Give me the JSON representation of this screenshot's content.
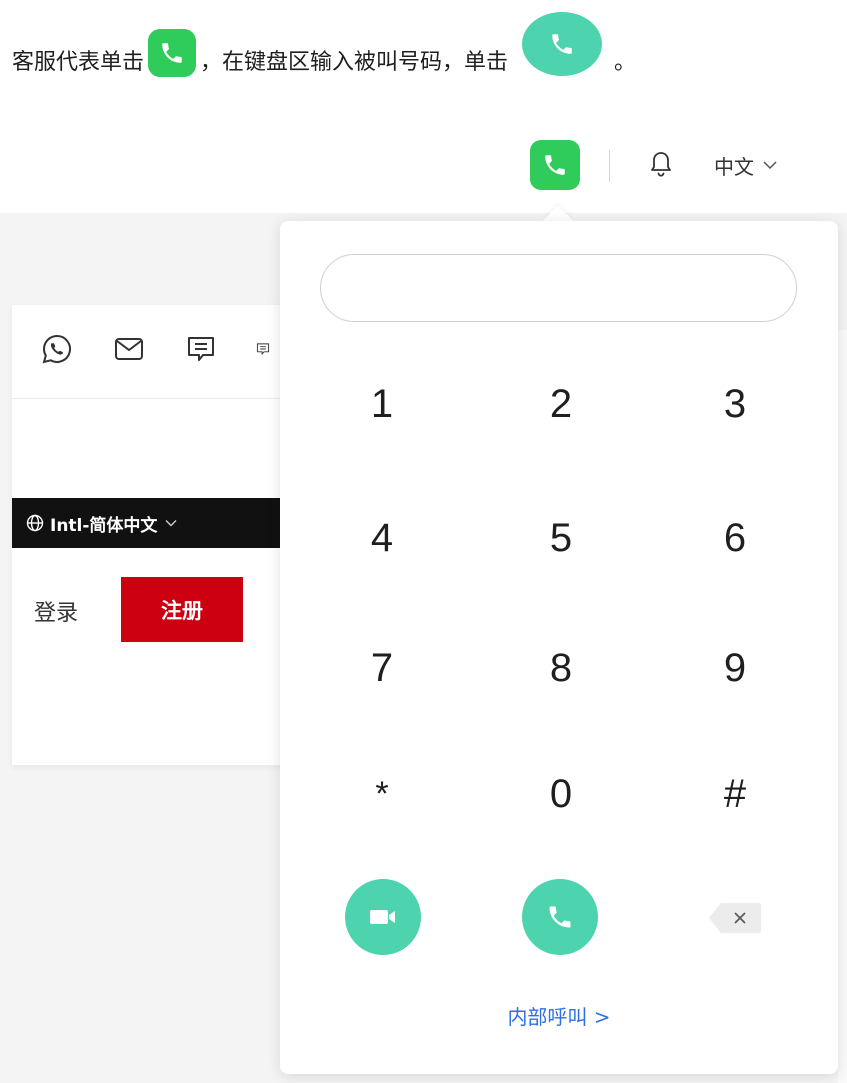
{
  "instruction": {
    "part1": "客服代表单击",
    "part2": "，在键盘区输入被叫号码，单击",
    "part3": "。",
    "icons": [
      "phone-icon",
      "call-icon"
    ]
  },
  "topbar": {
    "phone_icon": "phone-icon",
    "bell_icon": "bell-icon",
    "language_label": "中文",
    "language_chevron_icon": "chevron-down-icon"
  },
  "background_page": {
    "icons": [
      "whatsapp-icon",
      "mail-icon",
      "chat-icon",
      "message-icon"
    ],
    "region_label": "Intl-简体中文",
    "login_label": "登录",
    "register_label": "注册"
  },
  "dialpad": {
    "input_value": "",
    "keys": [
      "1",
      "2",
      "3",
      "4",
      "5",
      "6",
      "7",
      "8",
      "9",
      "*",
      "0",
      "#"
    ],
    "video_call_icon": "video-call-icon",
    "voice_call_icon": "call-icon",
    "backspace_icon": "backspace-icon",
    "internal_call_link": "内部呼叫 >"
  },
  "colors": {
    "green_square": "#2fcb5b",
    "teal_circle": "#4dd3ad",
    "register_red": "#cc0011",
    "link_blue": "#2f6fe8"
  }
}
